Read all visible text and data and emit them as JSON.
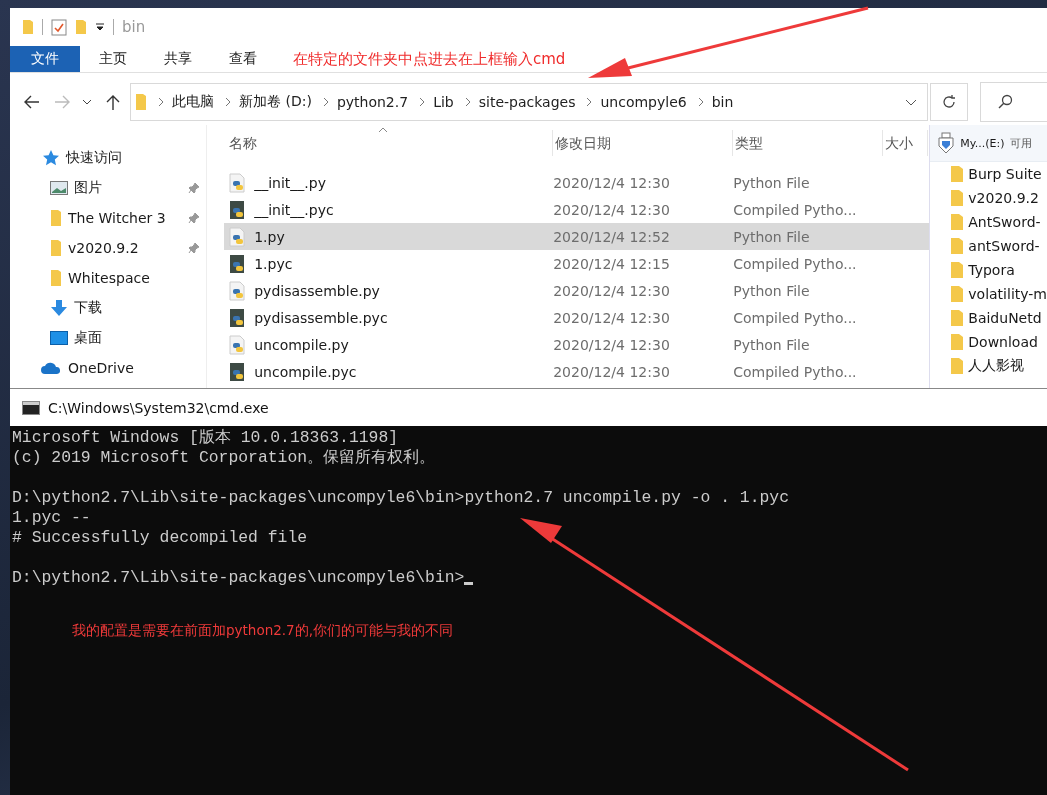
{
  "explorer": {
    "title": "bin",
    "ribbon_tabs": [
      {
        "label": "文件",
        "selected": true
      },
      {
        "label": "主页",
        "selected": false
      },
      {
        "label": "共享",
        "selected": false
      },
      {
        "label": "查看",
        "selected": false
      }
    ],
    "annotation": "在特定的文件夹中点进去在上框输入cmd",
    "breadcrumbs": [
      "此电脑",
      "新加卷 (D:)",
      "python2.7",
      "Lib",
      "site-packages",
      "uncompyle6",
      "bin"
    ],
    "nav_items": [
      {
        "label": "快速访问",
        "kind": "star",
        "pinned": false
      },
      {
        "label": "图片",
        "kind": "pictures",
        "pinned": true
      },
      {
        "label": "The Witcher 3",
        "kind": "folder",
        "pinned": true
      },
      {
        "label": "v2020.9.2",
        "kind": "folder",
        "pinned": true
      },
      {
        "label": "Whitespace",
        "kind": "folder",
        "pinned": false
      },
      {
        "label": "下载",
        "kind": "download",
        "pinned": false
      },
      {
        "label": "桌面",
        "kind": "desktop",
        "pinned": false
      },
      {
        "label": "OneDrive",
        "kind": "cloud",
        "pinned": false
      }
    ],
    "columns": [
      "名称",
      "修改日期",
      "类型",
      "大小"
    ],
    "files": [
      {
        "name": "__init__.py",
        "modified": "2020/12/4 12:30",
        "type": "Python File",
        "kind": "py",
        "selected": false
      },
      {
        "name": "__init__.pyc",
        "modified": "2020/12/4 12:30",
        "type": "Compiled Pytho...",
        "kind": "pyc",
        "selected": false
      },
      {
        "name": "1.py",
        "modified": "2020/12/4 12:52",
        "type": "Python File",
        "kind": "py",
        "selected": true
      },
      {
        "name": "1.pyc",
        "modified": "2020/12/4 12:15",
        "type": "Compiled Pytho...",
        "kind": "pyc",
        "selected": false
      },
      {
        "name": "pydisassemble.py",
        "modified": "2020/12/4 12:30",
        "type": "Python File",
        "kind": "py",
        "selected": false
      },
      {
        "name": "pydisassemble.pyc",
        "modified": "2020/12/4 12:30",
        "type": "Compiled Pytho...",
        "kind": "pyc",
        "selected": false
      },
      {
        "name": "uncompile.py",
        "modified": "2020/12/4 12:30",
        "type": "Python File",
        "kind": "py",
        "selected": false
      },
      {
        "name": "uncompile.pyc",
        "modified": "2020/12/4 12:30",
        "type": "Compiled Pytho...",
        "kind": "pyc",
        "selected": false
      }
    ],
    "side_panel": {
      "drive": "My...(E:)",
      "drive_note": "可用",
      "folders": [
        "Burp Suite",
        "v2020.9.2",
        "AntSword-",
        "antSword-",
        "Typora",
        "volatility-m",
        "BaiduNetd",
        "Download",
        "人人影视"
      ]
    }
  },
  "cmd": {
    "title": "C:\\Windows\\System32\\cmd.exe",
    "cursor_visible": true,
    "blocks": [
      [
        "Microsoft Windows [版本 10.0.18363.1198]",
        "(c) 2019 Microsoft Corporation。保留所有权利。"
      ],
      [
        "D:\\python2.7\\Lib\\site-packages\\uncompyle6\\bin>python2.7 uncompile.py -o . 1.pyc",
        "1.pyc --",
        "# Successfully decompiled file"
      ],
      [
        "D:\\python2.7\\Lib\\site-packages\\uncompyle6\\bin>"
      ]
    ],
    "annotation": "我的配置是需要在前面加python2.7的,你们的可能与我的不同"
  }
}
